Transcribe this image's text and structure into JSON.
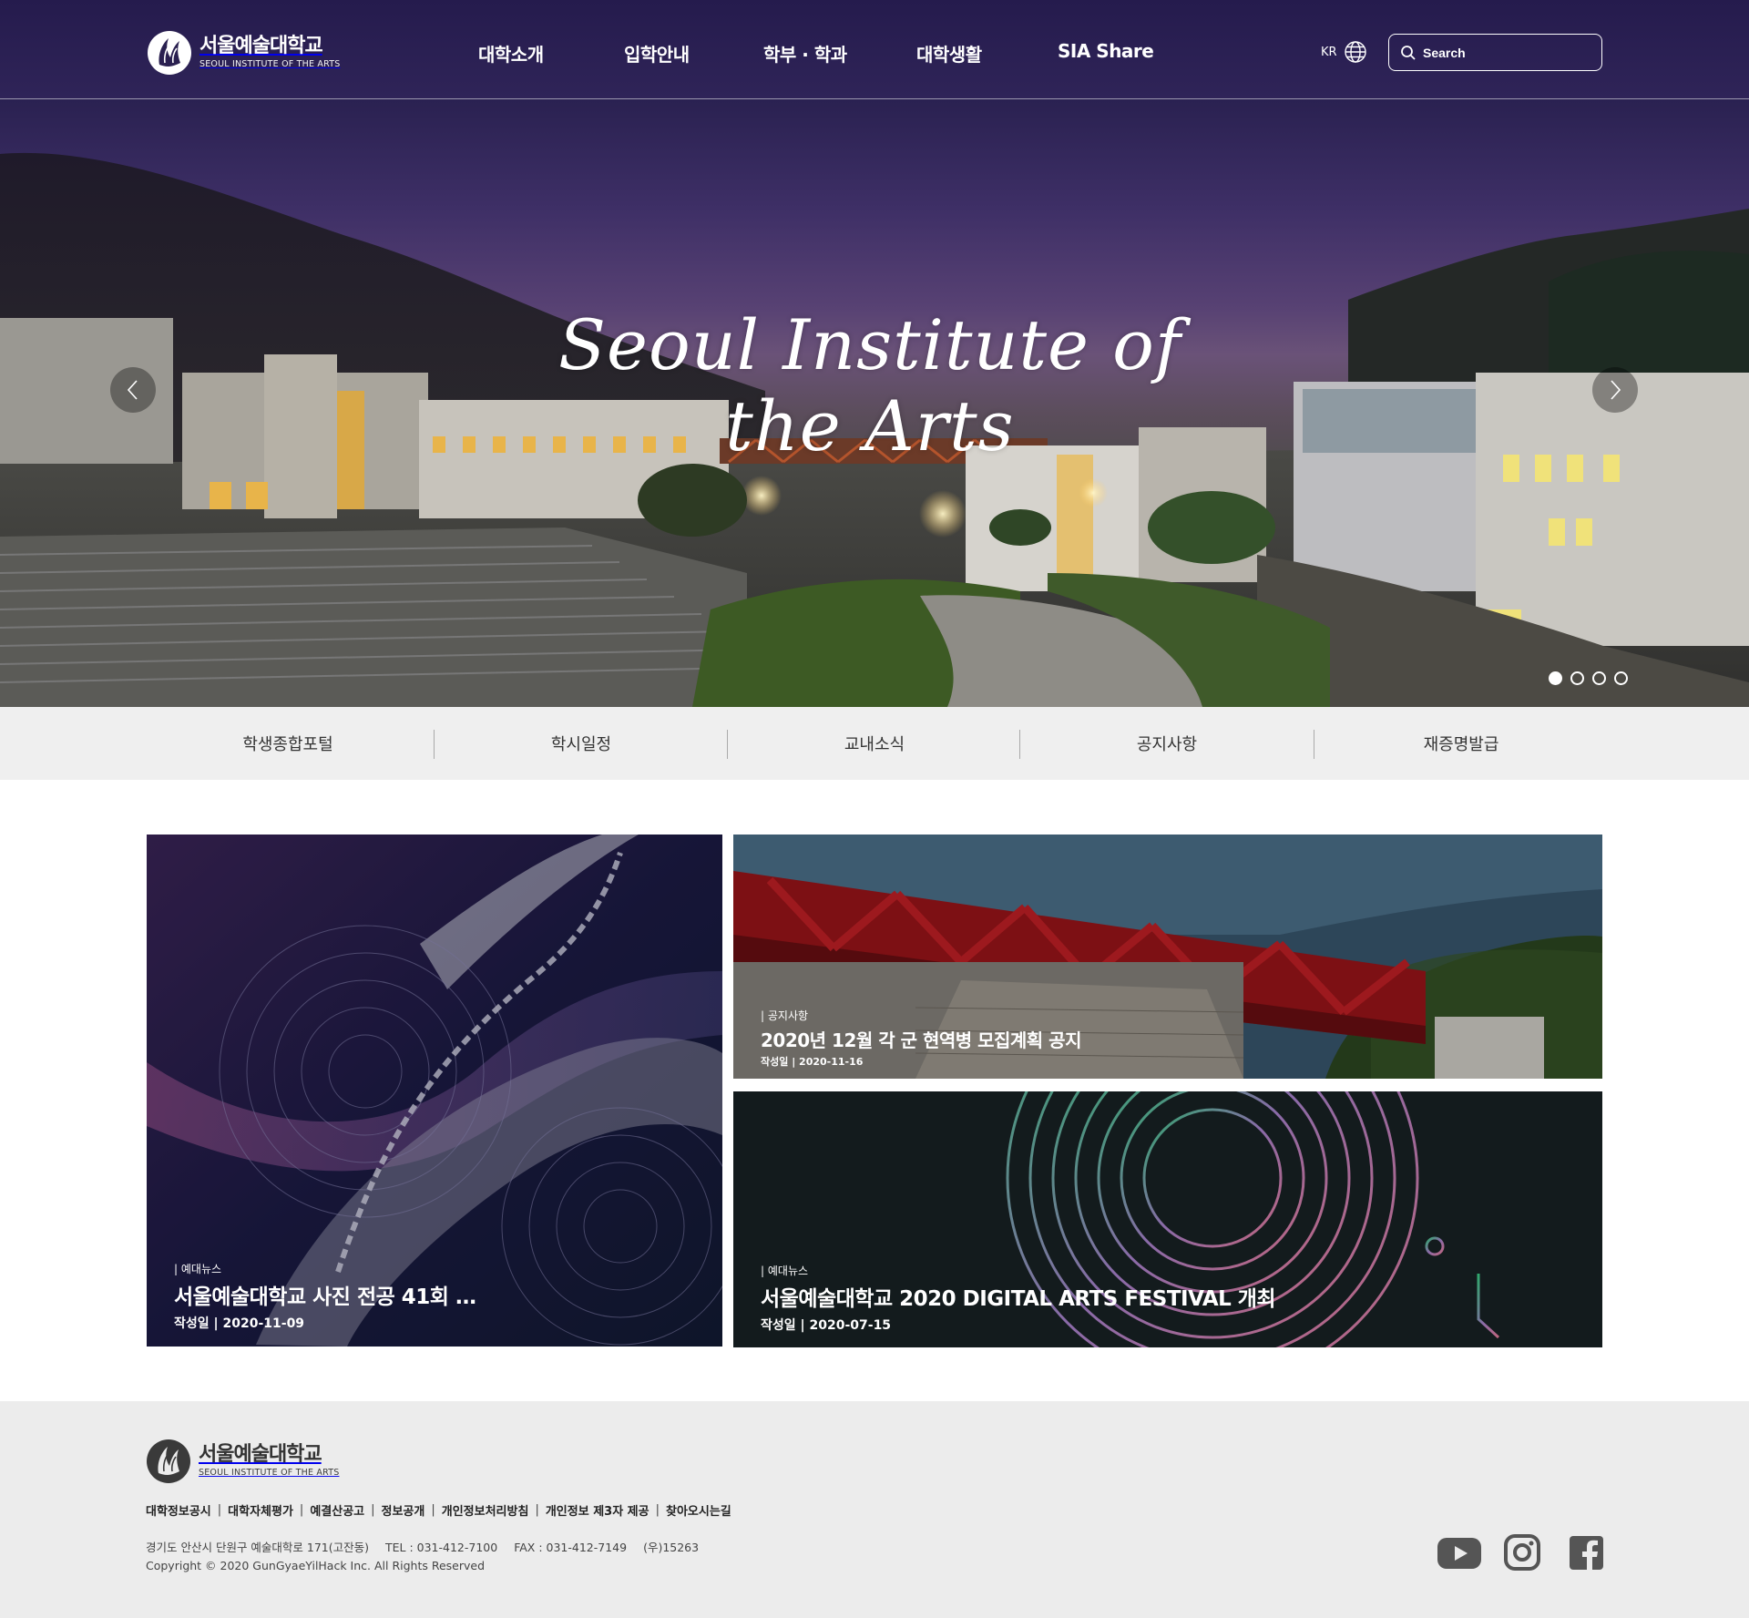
{
  "header": {
    "logo": {
      "name_ko": "서울예술대학교",
      "name_en": "SEOUL INSTITUTE OF THE ARTS"
    },
    "nav": [
      {
        "label": "대학소개"
      },
      {
        "label": "입학안내"
      },
      {
        "label": "학부 · 학과"
      },
      {
        "label": "대학생활"
      },
      {
        "label": "SIA Share"
      }
    ],
    "lang": "KR",
    "search": {
      "placeholder": "Search",
      "value": ""
    }
  },
  "hero": {
    "script_text": "Seoul Institute of the Arts",
    "slides_count": 4,
    "active_slide": 1,
    "icons": {
      "prev": "chevron-left-icon",
      "next": "chevron-right-icon"
    }
  },
  "quick_links": [
    {
      "label": "학생종합포털"
    },
    {
      "label": "학시일정"
    },
    {
      "label": "교내소식"
    },
    {
      "label": "공지사항"
    },
    {
      "label": "재증명발급"
    }
  ],
  "cards": {
    "large": {
      "category": "| 예대뉴스",
      "title": "서울예술대학교 사진 전공 41회 …",
      "date": "작성일 | 2020-11-09"
    },
    "top_right": {
      "category": "| 공지사항",
      "title": "2020년 12월 각 군 현역병 모집계획 공지",
      "date": "작성일 | 2020-11-16"
    },
    "bottom_right": {
      "category": "| 예대뉴스",
      "title": "서울예술대학교 2020 DIGITAL ARTS FESTIVAL 개최",
      "date": "작성일 | 2020-07-15"
    }
  },
  "footer": {
    "logo": {
      "name_ko": "서울예술대학교",
      "name_en": "SEOUL INSTITUTE OF THE ARTS"
    },
    "links": [
      {
        "label": "대학정보공시"
      },
      {
        "label": "대학자체평가"
      },
      {
        "label": "예결산공고"
      },
      {
        "label": "정보공개"
      },
      {
        "label": "개인정보처리방침"
      },
      {
        "label": "개인정보 제3자 제공"
      },
      {
        "label": "찾아오시는길"
      }
    ],
    "address": "경기도 안산시 단원구 예술대학로 171(고잔동)",
    "tel": "TEL : 031-412-7100",
    "fax": "FAX : 031-412-7149",
    "zip": "(우)15263",
    "copyright": "Copyright © 2020 GunGyaeYilHack Inc. All Rights Reserved",
    "social": [
      "youtube-icon",
      "instagram-icon",
      "facebook-icon"
    ]
  },
  "colors": {
    "header_bg": "#251b4d",
    "quickbar_bg": "#efefef",
    "footer_bg": "#ececec",
    "card_dark": "#131b1d",
    "bridge_red": "#c4161c"
  }
}
